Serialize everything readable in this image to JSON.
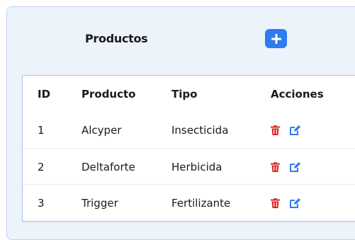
{
  "page": {
    "title": "Productos",
    "add_button_icon": "plus-icon",
    "colors": {
      "primary": "#2f7bf0",
      "delete": "#e02424",
      "edit": "#2f7bf0",
      "panel_bg": "#edf3fb"
    }
  },
  "table": {
    "headers": [
      "ID",
      "Producto",
      "Tipo",
      "Acciones"
    ],
    "rows": [
      {
        "id": "1",
        "producto": "Alcyper",
        "tipo": "Insecticida"
      },
      {
        "id": "2",
        "producto": "Deltaforte",
        "tipo": "Herbicida"
      },
      {
        "id": "3",
        "producto": "Trigger",
        "tipo": "Fertilizante"
      }
    ],
    "action_icons": [
      "trash-icon",
      "edit-icon"
    ]
  }
}
